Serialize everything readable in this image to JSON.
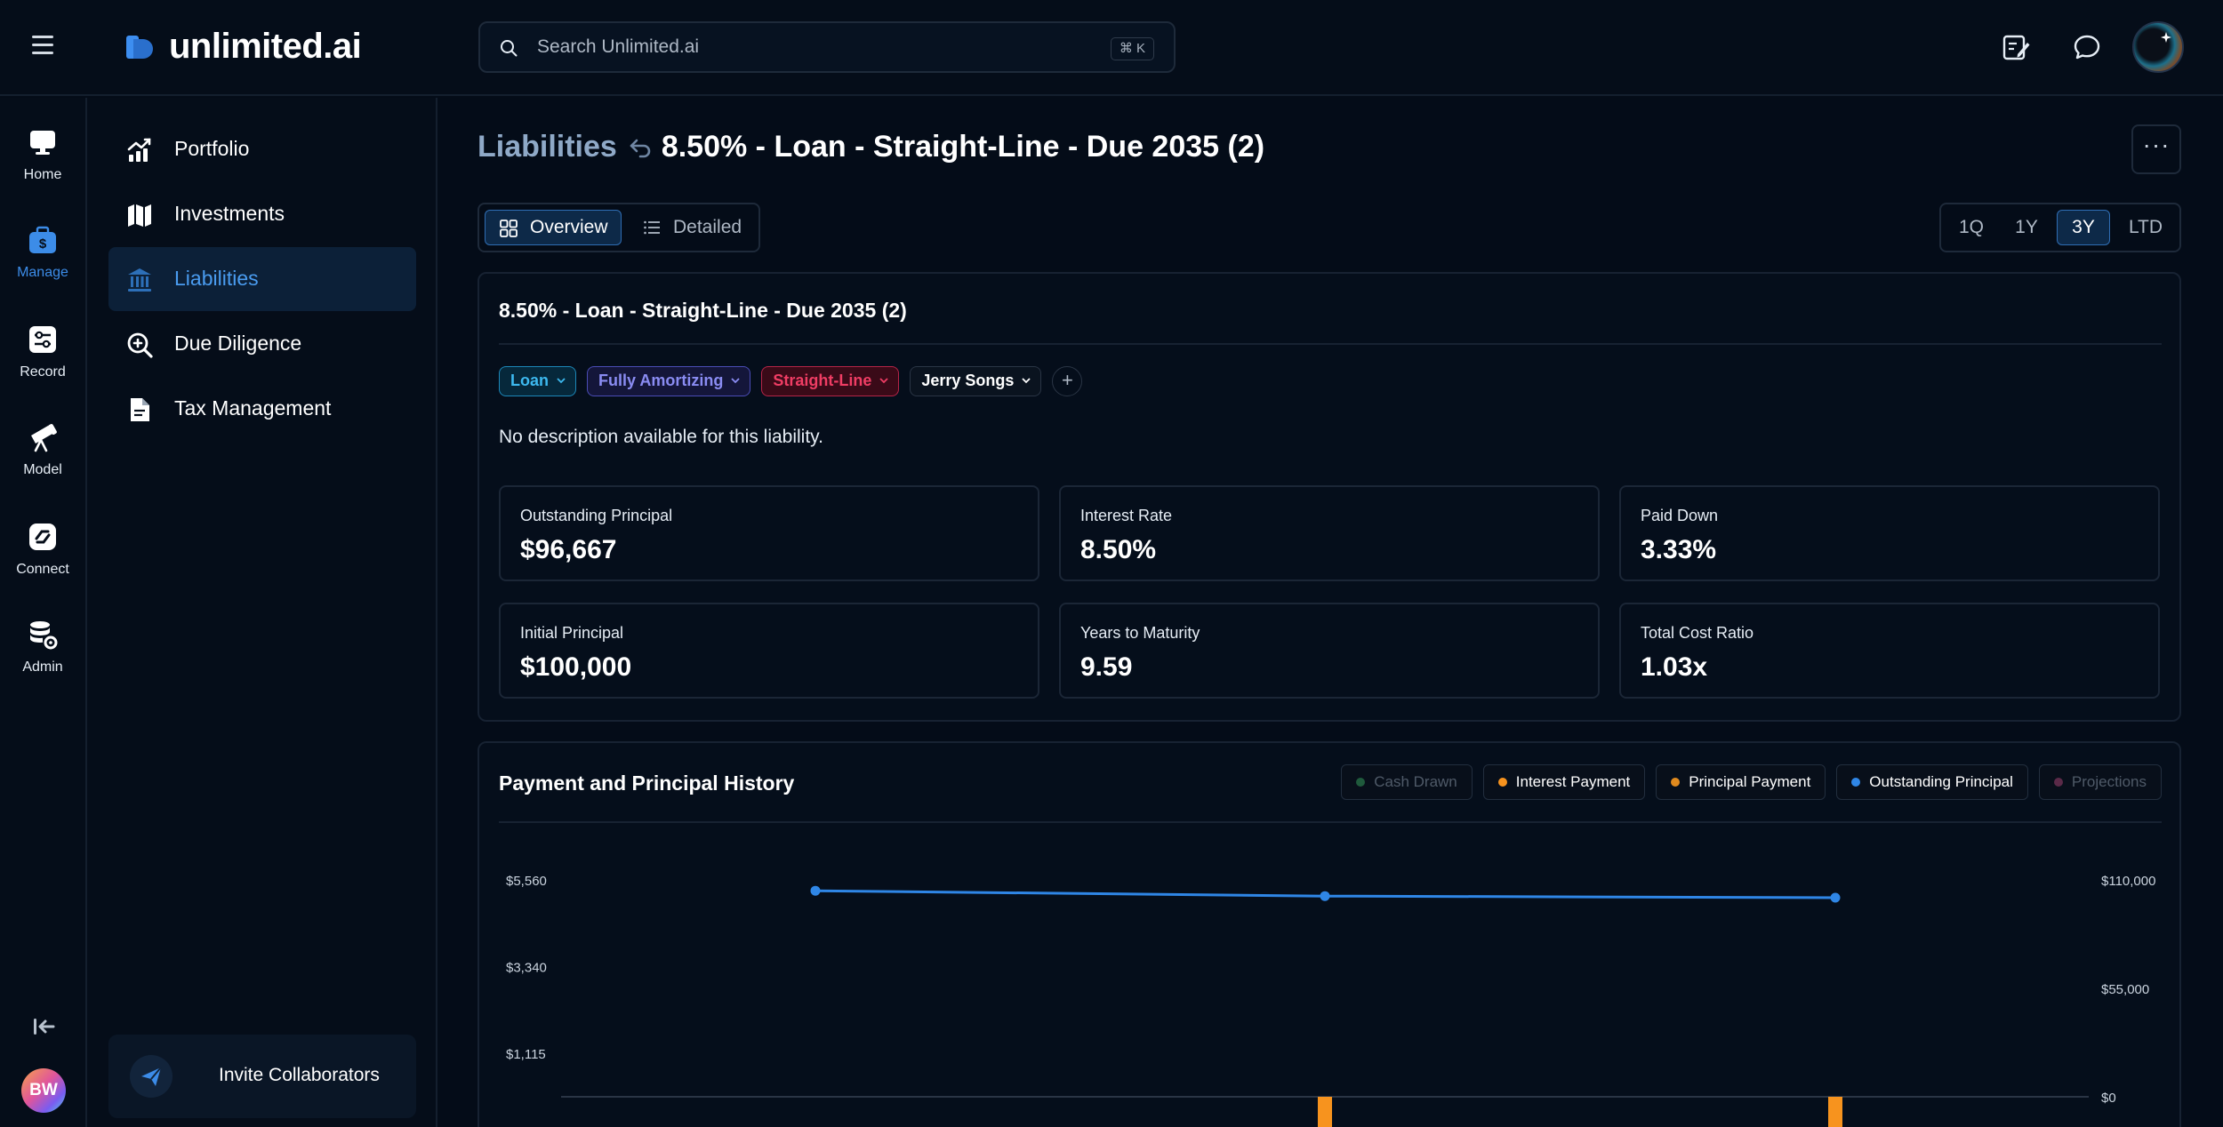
{
  "app": {
    "logo_text": "unlimited.ai"
  },
  "search": {
    "placeholder": "Search Unlimited.ai",
    "shortcut": "⌘ K"
  },
  "rail": {
    "items": [
      {
        "label": "Home",
        "icon": "monitor-icon"
      },
      {
        "label": "Manage",
        "icon": "briefcase-dollar-icon",
        "active": true
      },
      {
        "label": "Record",
        "icon": "sliders-icon"
      },
      {
        "label": "Model",
        "icon": "telescope-icon"
      },
      {
        "label": "Connect",
        "icon": "connect-icon"
      },
      {
        "label": "Admin",
        "icon": "database-gear-icon"
      }
    ],
    "user_initials": "BW"
  },
  "sidenav": {
    "items": [
      {
        "label": "Portfolio",
        "icon": "chart-up-icon"
      },
      {
        "label": "Investments",
        "icon": "map-icon"
      },
      {
        "label": "Liabilities",
        "icon": "bank-icon",
        "active": true
      },
      {
        "label": "Due Diligence",
        "icon": "search-zoom-icon"
      },
      {
        "label": "Tax Management",
        "icon": "document-icon"
      }
    ],
    "invite_label": "Invite Collaborators"
  },
  "page": {
    "breadcrumb_parent": "Liabilities",
    "title": "8.50% - Loan - Straight-Line - Due 2035 (2)",
    "more_label": "···"
  },
  "view_toggle": {
    "overview": "Overview",
    "detailed": "Detailed",
    "active": "overview"
  },
  "periods": {
    "items": [
      "1Q",
      "1Y",
      "3Y",
      "LTD"
    ],
    "active": "3Y"
  },
  "summary": {
    "title": "8.50% - Loan - Straight-Line - Due 2035 (2)",
    "tags": {
      "type": "Loan",
      "amortization": "Fully Amortizing",
      "method": "Straight-Line",
      "owner": "Jerry Songs",
      "add": "+"
    },
    "description": "No description available for this liability.",
    "stats": [
      {
        "label": "Outstanding Principal",
        "value": "$96,667"
      },
      {
        "label": "Interest Rate",
        "value": "8.50%"
      },
      {
        "label": "Paid Down",
        "value": "3.33%"
      },
      {
        "label": "Initial Principal",
        "value": "$100,000"
      },
      {
        "label": "Years to Maturity",
        "value": "9.59"
      },
      {
        "label": "Total Cost Ratio",
        "value": "1.03x"
      }
    ]
  },
  "chart": {
    "title": "Payment and Principal History",
    "legend": [
      {
        "label": "Cash Drawn",
        "color": "#1f5a3c",
        "enabled": false
      },
      {
        "label": "Interest Payment",
        "color": "#f7931e",
        "enabled": true
      },
      {
        "label": "Principal Payment",
        "color": "#e08a1e",
        "enabled": true
      },
      {
        "label": "Outstanding Principal",
        "color": "#2f86e6",
        "enabled": true
      },
      {
        "label": "Projections",
        "color": "#5a2a48",
        "enabled": false
      }
    ]
  },
  "chart_data": {
    "type": "line",
    "title": "Payment and Principal History",
    "y_left_ticks": [
      "$5,560",
      "$3,340",
      "$1,115"
    ],
    "y_left_values": [
      5560,
      3340,
      1115
    ],
    "y_right_ticks": [
      "$110,000",
      "$55,000",
      "$0"
    ],
    "y_right_values": [
      110000,
      55000,
      0
    ],
    "ylim_left": [
      0,
      5560
    ],
    "ylim_right": [
      0,
      110000
    ],
    "series": [
      {
        "name": "Outstanding Principal",
        "axis": "right",
        "color": "#2f86e6",
        "values": [
          104500,
          101800,
          101000
        ]
      },
      {
        "name": "Interest Payment",
        "axis": "left",
        "color": "#f7931e",
        "values": [
          null,
          850,
          850
        ]
      }
    ]
  }
}
